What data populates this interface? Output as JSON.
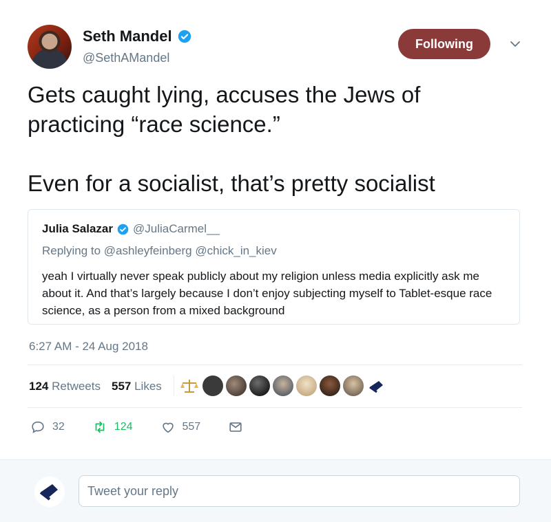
{
  "author": {
    "name": "Seth Mandel",
    "handle": "@SethAMandel",
    "verified": true
  },
  "follow_button": {
    "label": "Following",
    "color": "#8b3a3a"
  },
  "tweet": {
    "text": "Gets caught lying, accuses the Jews of practicing “race science.”\n\nEven for a socialist, that’s pretty socialist"
  },
  "quoted_tweet": {
    "name": "Julia Salazar",
    "handle": "@JuliaCarmel__",
    "replying_prefix": "Replying to",
    "replying_to": [
      "@ashleyfeinberg",
      "@chick_in_kiev"
    ],
    "text": "yeah I virtually never speak publicly about my religion unless media explicitly ask me about it. And that’s largely because I don’t enjoy subjecting myself to Tablet-esque race science, as a person from a mixed background"
  },
  "timestamp": "6:27 AM - 24 Aug 2018",
  "stats": {
    "retweets_count": "124",
    "retweets_label": "Retweets",
    "likes_count": "557",
    "likes_label": "Likes"
  },
  "actions": {
    "reply_count": "32",
    "retweet_count": "124",
    "like_count": "557"
  },
  "reply_box": {
    "placeholder": "Tweet your reply"
  },
  "colors": {
    "retweet_green": "#17bf63",
    "verified_blue": "#1da1f2",
    "muted_text": "#657786"
  }
}
